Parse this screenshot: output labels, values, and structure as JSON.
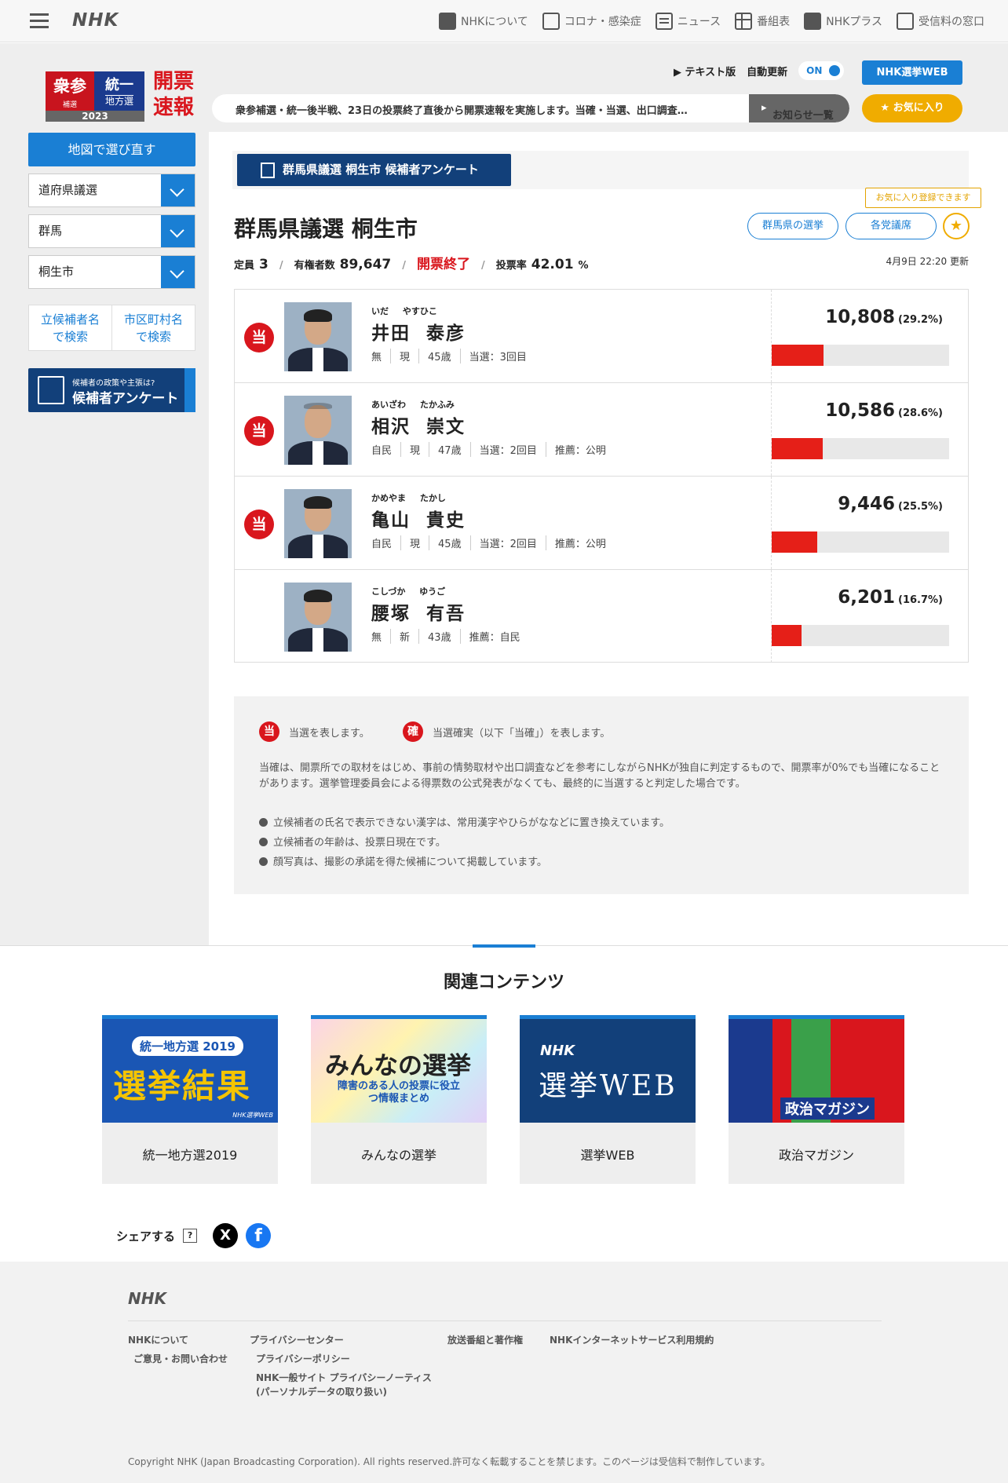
{
  "header": {
    "logo": "NHK",
    "nav": [
      {
        "label": "NHKについて",
        "icon": "nhk-icon"
      },
      {
        "label": "コロナ・感染症",
        "icon": "virus-icon"
      },
      {
        "label": "ニュース",
        "icon": "news-icon"
      },
      {
        "label": "番組表",
        "icon": "schedule-icon"
      },
      {
        "label": "NHKプラス",
        "icon": "nhkplus-icon"
      },
      {
        "label": "受信料の窓口",
        "icon": "tv-icon"
      }
    ]
  },
  "brand": {
    "left_big": "衆参",
    "left_small": "補選",
    "right_big": "統一",
    "right_small": "地方選",
    "year": "2023",
    "sokuho_1": "開票",
    "sokuho_2": "速報"
  },
  "controls": {
    "text_version": "テキスト版",
    "auto_update": "自動更新",
    "toggle": "ON",
    "web_button": "NHK選挙WEB",
    "news": "衆参補選・統一後半戦、23日の投票終了直後から開票速報を実施します。当確・当選、出口調査…",
    "news_list": "お知らせ一覧",
    "favorite": "お気に入り"
  },
  "sidebar": {
    "map_button": "地図で選び直す",
    "select1": "道府県議選",
    "select2": "群馬",
    "select3": "桐生市",
    "search_name_1": "立候補者名",
    "search_name_2": "で検索",
    "search_city_1": "市区町村名",
    "search_city_2": "で検索",
    "survey_small": "候補者の政策や主張は?",
    "survey_big": "候補者アンケート"
  },
  "main": {
    "survey_button": "群馬県議選 桐生市 候補者アンケート",
    "fav_hint": "お気に入り登録できます",
    "title": "群馬県議選 桐生市",
    "pill1": "群馬県の選挙",
    "pill2": "各党議席",
    "stats": {
      "teiin_label": "定員",
      "teiin": "3",
      "voters_label": "有権者数",
      "voters": "89,647",
      "status": "開票終了",
      "turnout_label": "投票率",
      "turnout": "42.01",
      "pct": "%"
    },
    "updated": "4月9日 22:20 更新"
  },
  "candidates": [
    {
      "mark": "当",
      "kana": "いだ やすひこ",
      "name": "井田 泰彦",
      "meta": [
        "無",
        "現",
        "45歳",
        "当選：3回目"
      ],
      "votes": "10,808",
      "pct": "(29.2%)",
      "share": 0.292
    },
    {
      "mark": "当",
      "kana": "あいざわ たかふみ",
      "name": "相沢 崇文",
      "meta": [
        "自民",
        "現",
        "47歳",
        "当選：2回目",
        "推薦：公明"
      ],
      "votes": "10,586",
      "pct": "(28.6%)",
      "share": 0.286
    },
    {
      "mark": "当",
      "kana": "かめやま たかし",
      "name": "亀山 貴史",
      "meta": [
        "自民",
        "現",
        "45歳",
        "当選：2回目",
        "推薦：公明"
      ],
      "votes": "9,446",
      "pct": "(25.5%)",
      "share": 0.255
    },
    {
      "mark": "",
      "kana": "こしづか ゆうご",
      "name": "腰塚 有吾",
      "meta": [
        "無",
        "新",
        "43歳",
        "推薦：自民"
      ],
      "votes": "6,201",
      "pct": "(16.7%)",
      "share": 0.167
    }
  ],
  "notes": {
    "mark1": "当",
    "text1": "当選を表します。",
    "mark2": "確",
    "text2": "当選確実（以下「当確」）を表します。",
    "para": "当確は、開票所での取材をはじめ、事前の情勢取材や出口調査などを参考にしながらNHKが独自に判定するもので、開票率が0%でも当確になることがあります。選挙管理委員会による得票数の公式発表がなくても、最終的に当選すると判定した場合です。",
    "bullets": [
      "立候補者の氏名で表示できない漢字は、常用漢字やひらがななどに置き換えています。",
      "立候補者の年齢は、投票日現在です。",
      "顔写真は、撮影の承諾を得た候補について掲載しています。"
    ]
  },
  "related": {
    "title": "関連コンテンツ",
    "cards": [
      {
        "label": "統一地方選2019",
        "img_badge": "統一地方選 2019",
        "img_main": "選挙結果",
        "img_foot": "NHK選挙WEB"
      },
      {
        "label": "みんなの選挙",
        "img_main": "みんなの選挙",
        "img_sub": "障害のある人の投票に役立つ情報まとめ"
      },
      {
        "label": "選挙WEB",
        "img_badge": "NHK",
        "img_main": "選挙WEB"
      },
      {
        "label": "政治マガジン",
        "img_main": "政治マガジン"
      }
    ]
  },
  "share": {
    "label": "シェアする",
    "help": "?",
    "x": "X",
    "fb": "f"
  },
  "footer": {
    "logo": "NHK",
    "links": [
      "NHKについて",
      "ご意見・お問い合わせ",
      "プライバシーセンター",
      "プライバシーポリシー",
      "NHK一般サイト プライバシーノーティス",
      "(パーソナルデータの取り扱い)",
      "放送番組と著作権",
      "NHKインターネットサービス利用規約"
    ],
    "copyright": "Copyright NHK (Japan Broadcasting Corporation). All rights reserved.許可なく転載することを禁じます。このページは受信料で制作しています。"
  },
  "colors": {
    "accent": "#1a7fd4",
    "navy": "#12407a",
    "red": "#d9161d",
    "gold": "#f0ac00"
  }
}
